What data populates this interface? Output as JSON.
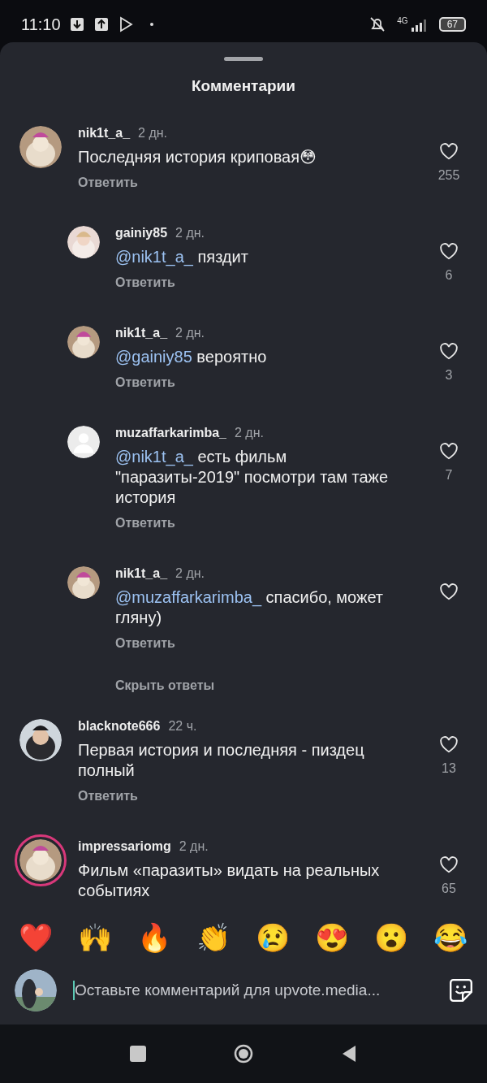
{
  "status_bar": {
    "time": "11:10",
    "network": "4G",
    "battery": "67"
  },
  "header": {
    "title": "Комментарии"
  },
  "comments": [
    {
      "username": "nik1t_a_",
      "time": "2 дн.",
      "text": "Последняя история криповая😳",
      "reply_label": "Ответить",
      "likes": "255",
      "replies": [
        {
          "username": "gainiy85",
          "time": "2 дн.",
          "mention": "@nik1t_a_",
          "text": "пяздит",
          "reply_label": "Ответить",
          "likes": "6"
        },
        {
          "username": "nik1t_a_",
          "time": "2 дн.",
          "mention": "@gainiy85",
          "text": "вероятно",
          "reply_label": "Ответить",
          "likes": "3"
        },
        {
          "avatar": {
            "kind": "default"
          },
          "username": "muzaffarkarimba_",
          "time": "2 дн.",
          "mention": "@nik1t_a_",
          "text": "есть фильм \"паразиты-2019\" посмотри там таже история",
          "reply_label": "Ответить",
          "likes": "7"
        },
        {
          "username": "nik1t_a_",
          "time": "2 дн.",
          "mention": "@muzaffarkarimba_",
          "text": "спасибо, может гляну)",
          "reply_label": "Ответить"
        }
      ],
      "hide_replies": "Скрыть ответы"
    },
    {
      "username": "blacknote666",
      "time": "22 ч.",
      "text": "Первая история и последняя - пиздец полный",
      "reply_label": "Ответить",
      "likes": "13"
    },
    {
      "avatar": {
        "kind": "story"
      },
      "username": "impressariomg",
      "time": "2 дн.",
      "text": "Фильм «паразиты» видать на реальных событиях",
      "likes": "65"
    }
  ],
  "reactions": [
    "❤️",
    "🙌",
    "🔥",
    "👏",
    "😢",
    "😍",
    "😮",
    "😂"
  ],
  "composer": {
    "placeholder": "Оставьте комментарий для upvote.media..."
  }
}
